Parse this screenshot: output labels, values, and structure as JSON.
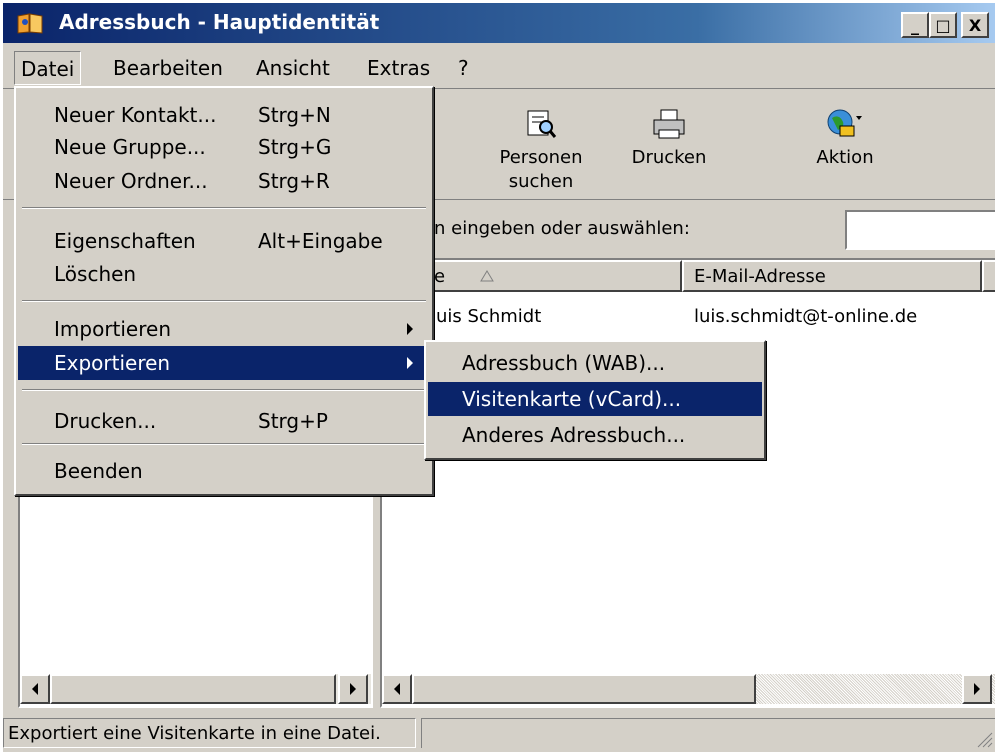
{
  "window": {
    "title": "Adressbuch - Hauptidentität",
    "minimize_glyph": "_",
    "maximize_glyph": "□",
    "close_glyph": "X"
  },
  "menubar": [
    "Datei",
    "Bearbeiten",
    "Ansicht",
    "Extras",
    "?"
  ],
  "toolbar": {
    "search": "Personen suchen",
    "search_line1": "Personen",
    "search_line2": "suchen",
    "print": "Drucken",
    "action": "Aktion"
  },
  "search_prompt": "n eingeben oder auswählen:",
  "columns": {
    "name": "e",
    "email": "E-Mail-Adresse"
  },
  "contacts": [
    {
      "name": "uis Schmidt",
      "email": "luis.schmidt@t-online.de"
    }
  ],
  "file_menu": {
    "new_contact": "Neuer Kontakt...",
    "new_contact_key": "Strg+N",
    "new_group": "Neue Gruppe...",
    "new_group_key": "Strg+G",
    "new_folder": "Neuer Ordner...",
    "new_folder_key": "Strg+R",
    "properties": "Eigenschaften",
    "properties_key": "Alt+Eingabe",
    "delete": "Löschen",
    "import": "Importieren",
    "export": "Exportieren",
    "print": "Drucken...",
    "print_key": "Strg+P",
    "exit": "Beenden"
  },
  "export_submenu": [
    "Adressbuch (WAB)...",
    "Visitenkarte (vCard)...",
    "Anderes Adressbuch..."
  ],
  "status_text": "Exportiert eine Visitenkarte in eine Datei.",
  "colors": {
    "highlight": "#0a246a",
    "face": "#d4d0c8",
    "title_start": "#0a246a",
    "title_end": "#a6caf0"
  }
}
